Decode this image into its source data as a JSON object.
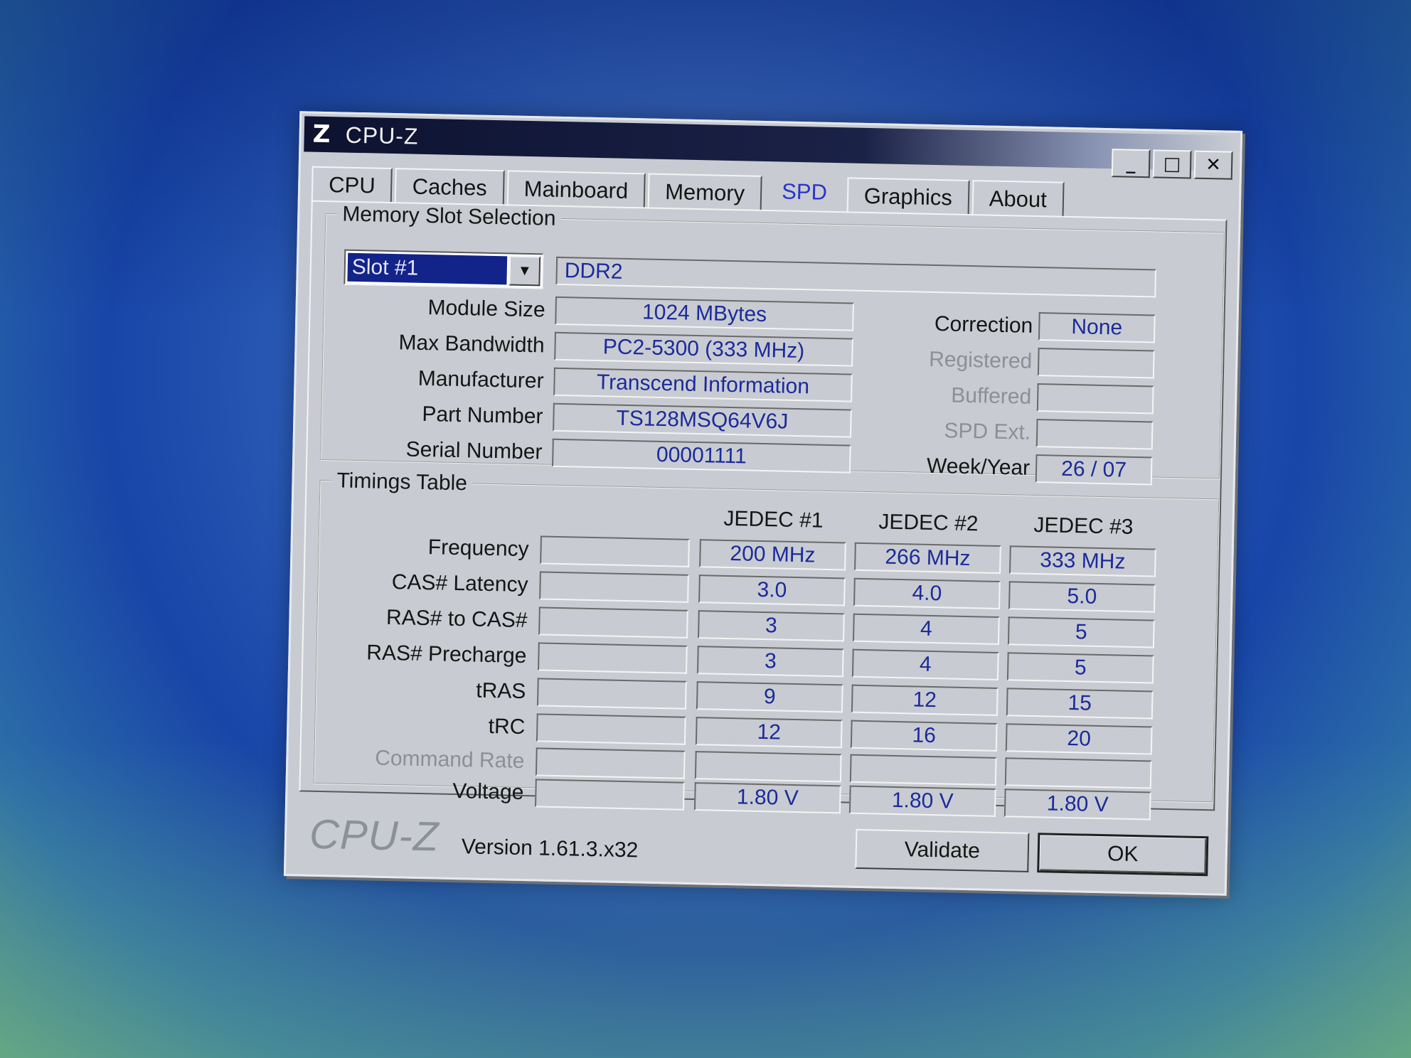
{
  "window": {
    "title": "CPU-Z",
    "icon_glyph": "Z",
    "controls": {
      "minimize": "_",
      "maximize": "□",
      "close": "✕"
    }
  },
  "tabs": [
    {
      "label": "CPU"
    },
    {
      "label": "Caches"
    },
    {
      "label": "Mainboard"
    },
    {
      "label": "Memory"
    },
    {
      "label": "SPD",
      "active": true
    },
    {
      "label": "Graphics"
    },
    {
      "label": "About"
    }
  ],
  "slot_selection": {
    "legend": "Memory Slot Selection",
    "slot_value": "Slot #1",
    "type": "DDR2",
    "module_size_label": "Module Size",
    "module_size": "1024 MBytes",
    "max_bandwidth_label": "Max Bandwidth",
    "max_bandwidth": "PC2-5300 (333 MHz)",
    "manufacturer_label": "Manufacturer",
    "manufacturer": "Transcend Information",
    "part_number_label": "Part Number",
    "part_number": "TS128MSQ64V6J",
    "serial_number_label": "Serial Number",
    "serial_number": "00001111",
    "correction_label": "Correction",
    "correction": "None",
    "registered_label": "Registered",
    "registered": "",
    "buffered_label": "Buffered",
    "buffered": "",
    "spd_ext_label": "SPD Ext.",
    "spd_ext": "",
    "week_year_label": "Week/Year",
    "week_year": "26 / 07"
  },
  "timings": {
    "legend": "Timings Table",
    "columns": [
      "JEDEC #1",
      "JEDEC #2",
      "JEDEC #3"
    ],
    "rows": [
      {
        "label": "Frequency",
        "xmp": "",
        "values": [
          "200 MHz",
          "266 MHz",
          "333 MHz"
        ]
      },
      {
        "label": "CAS# Latency",
        "xmp": "",
        "values": [
          "3.0",
          "4.0",
          "5.0"
        ]
      },
      {
        "label": "RAS# to CAS#",
        "xmp": "",
        "values": [
          "3",
          "4",
          "5"
        ]
      },
      {
        "label": "RAS# Precharge",
        "xmp": "",
        "values": [
          "3",
          "4",
          "5"
        ]
      },
      {
        "label": "tRAS",
        "xmp": "",
        "values": [
          "9",
          "12",
          "15"
        ]
      },
      {
        "label": "tRC",
        "xmp": "",
        "values": [
          "12",
          "16",
          "20"
        ]
      },
      {
        "label": "Command Rate",
        "xmp": "",
        "values": [
          "",
          "",
          ""
        ],
        "disabled": true
      },
      {
        "label": "Voltage",
        "xmp": "",
        "values": [
          "1.80 V",
          "1.80 V",
          "1.80 V"
        ]
      }
    ]
  },
  "footer": {
    "logo": "CPU-Z",
    "version": "Version 1.61.3.x32",
    "validate_label": "Validate",
    "ok_label": "OK"
  },
  "colors": {
    "value_text": "#1c2a9a",
    "active_tab": "#2a35c9",
    "window_bg": "#c8ccd2",
    "titlebar": "#0d1230"
  }
}
